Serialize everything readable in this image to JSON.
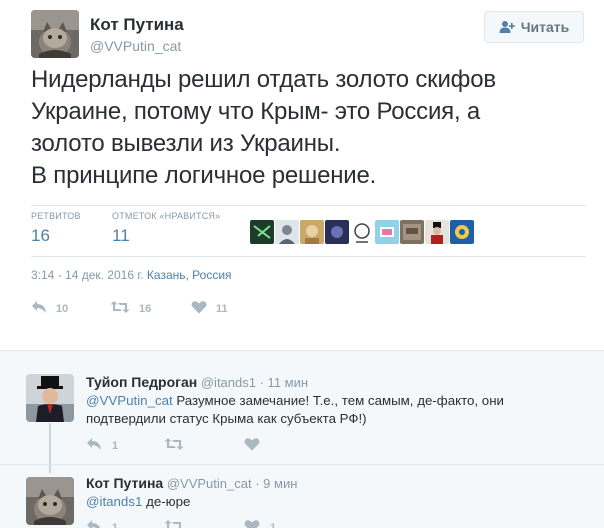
{
  "tweet": {
    "author_name": "Кот Путина",
    "author_handle": "@VVPutin_cat",
    "follow_label": "Читать",
    "text_lines": [
      "Нидерланды решил отдать золото скифов",
      "Украине, потому что Крым- это Россия, а",
      "золото вывезли из Украины.",
      "В принципе логичное решение."
    ],
    "stats": {
      "retweets_label": "РЕТВИТОВ",
      "retweets_value": "16",
      "likes_label": "ОТМЕТОК «НРАВИТСЯ»",
      "likes_value": "11"
    },
    "likers_count": 9,
    "meta": {
      "time": "3:14 - 14 дек. 2016 г.",
      "location": "Казань, Россия"
    },
    "actions": {
      "reply_count": "10",
      "retweet_count": "16",
      "like_count": "11"
    }
  },
  "replies": [
    {
      "name": "Туйоп Педроган",
      "handle": "@itands1",
      "time": "· 11 мин",
      "mention": "@VVPutin_cat",
      "text_rest": " Разумное замечание! Т.е., тем самым, де-факто, они",
      "text_line2": "подтвердили статус Крыма как субъекта РФ!)",
      "reply_count": "1",
      "retweet_count": "",
      "like_count": ""
    },
    {
      "name": "Кот Путина",
      "handle": "@VVPutin_cat",
      "time": "· 9 мин",
      "mention": "@itands1",
      "text_rest": " де-юре",
      "reply_count": "1",
      "retweet_count": "",
      "like_count": "1"
    }
  ],
  "colors": {
    "link": "#4f81a8",
    "muted": "#8899a6",
    "text": "#292f33",
    "icon": "#aab8c2",
    "reply_bg": "#f5f8fa"
  }
}
